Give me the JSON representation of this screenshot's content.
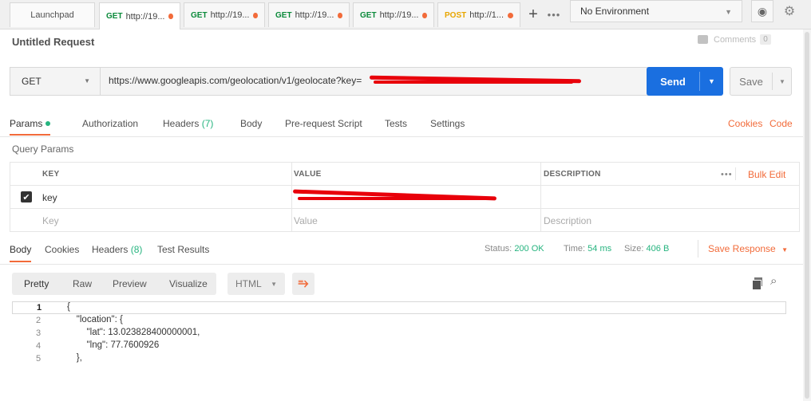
{
  "tabs": {
    "launchpad": "Launchpad",
    "items": [
      {
        "method": "GET",
        "label": "http://19..."
      },
      {
        "method": "GET",
        "label": "http://19..."
      },
      {
        "method": "GET",
        "label": "http://19..."
      },
      {
        "method": "GET",
        "label": "http://19..."
      },
      {
        "method": "POST",
        "label": "http://1..."
      }
    ],
    "add_icon": "+",
    "more_icon": "•••"
  },
  "environment": {
    "selected": "No Environment"
  },
  "request": {
    "title": "Untitled Request",
    "comments_label": "Comments",
    "comments_count": "0",
    "method": "GET",
    "url": "https://www.googleapis.com/geolocation/v1/geolocate?key=",
    "send_label": "Send",
    "save_label": "Save"
  },
  "request_tabs": {
    "params": "Params",
    "authorization": "Authorization",
    "headers": "Headers",
    "headers_count": "(7)",
    "body": "Body",
    "prerequest": "Pre-request Script",
    "tests": "Tests",
    "settings": "Settings",
    "cookies": "Cookies",
    "code": "Code"
  },
  "query_params": {
    "title": "Query Params",
    "headers": {
      "key": "KEY",
      "value": "VALUE",
      "description": "DESCRIPTION",
      "more": "•••",
      "bulk_edit": "Bulk Edit"
    },
    "rows": [
      {
        "key": "key",
        "value": "",
        "description": "",
        "checked": true
      }
    ],
    "placeholders": {
      "key": "Key",
      "value": "Value",
      "description": "Description"
    }
  },
  "response_tabs": {
    "body": "Body",
    "cookies": "Cookies",
    "headers": "Headers",
    "headers_count": "(8)",
    "test_results": "Test Results"
  },
  "response_meta": {
    "status_label": "Status:",
    "status_value": "200 OK",
    "time_label": "Time:",
    "time_value": "54 ms",
    "size_label": "Size:",
    "size_value": "406 B",
    "save_response": "Save Response"
  },
  "response_toolbar": {
    "pretty": "Pretty",
    "raw": "Raw",
    "preview": "Preview",
    "visualize": "Visualize",
    "format": "HTML"
  },
  "code_lines": [
    {
      "n": "1",
      "t": "{"
    },
    {
      "n": "2",
      "t": "    \"location\": {"
    },
    {
      "n": "3",
      "t": "        \"lat\": 13.023828400000001,"
    },
    {
      "n": "4",
      "t": "        \"lng\": 77.7600926"
    },
    {
      "n": "5",
      "t": "    },"
    }
  ],
  "colors": {
    "accent": "#f26b3a",
    "send": "#1a6fe0",
    "success": "#26b47f",
    "redaction": "#e8000a"
  }
}
